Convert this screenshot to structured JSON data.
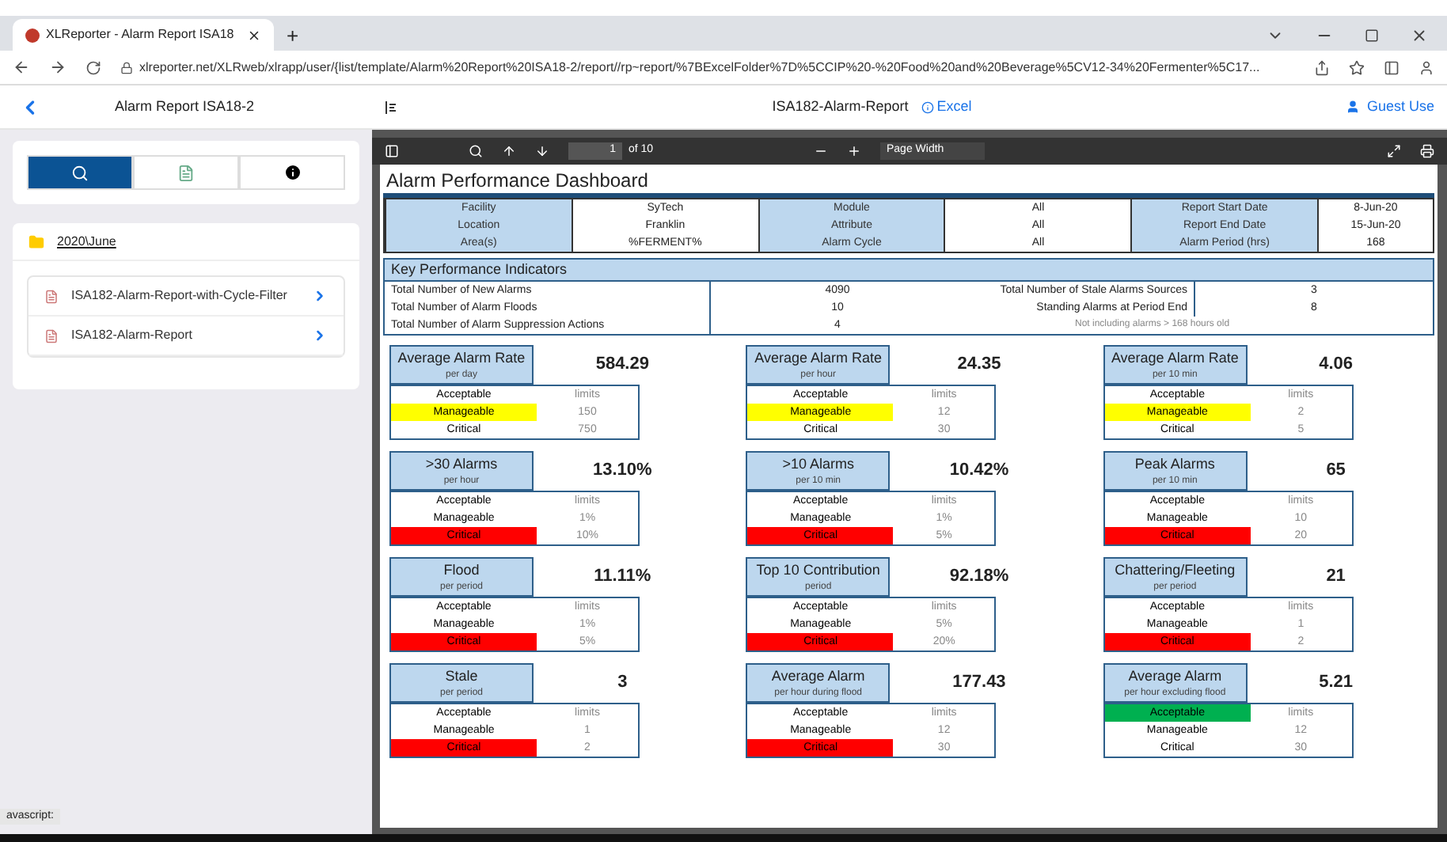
{
  "browser": {
    "tab_title": "XLReporter - Alarm Report ISA18",
    "new_tab": "+",
    "url": "xlreporter.net/XLRweb/xlrapp/user/{list/template/Alarm%20Report%20ISA18-2/report//rp~report/%7BExcelFolder%7D%5CCIP%20-%20Food%20and%20Beverage%5CV12-34%20Fermenter%5C17..."
  },
  "app_header": {
    "title": "Alarm Report ISA18-2",
    "report_name": "ISA182-Alarm-Report",
    "excel_link": "Excel",
    "user": "Guest Use"
  },
  "sidebar": {
    "view_tabs": [
      {
        "selected": true
      },
      {
        "selected": false
      },
      {
        "selected": false
      }
    ],
    "folder": "2020\\June",
    "reports": [
      {
        "name": "ISA182-Alarm-Report-with-Cycle-Filter"
      },
      {
        "name": "ISA182-Alarm-Report"
      }
    ]
  },
  "pdf_toolbar": {
    "page": "1",
    "page_total": "of 10",
    "zoom": "Page Width"
  },
  "report": {
    "title": "Alarm Performance Dashboard",
    "info": [
      [
        {
          "label": "Facility",
          "value": "SyTech"
        },
        {
          "label": "Module",
          "value": "All"
        },
        {
          "label": "Report Start Date",
          "value": "8-Jun-20"
        }
      ],
      [
        {
          "label": "Location",
          "value": "Franklin"
        },
        {
          "label": "Attribute",
          "value": "All"
        },
        {
          "label": "Report End Date",
          "value": "15-Jun-20"
        }
      ],
      [
        {
          "label": "Area(s)",
          "value": "%FERMENT%"
        },
        {
          "label": "Alarm Cycle",
          "value": "All"
        },
        {
          "label": "Alarm Period (hrs)",
          "value": "168"
        }
      ]
    ],
    "kpi_title": "Key Performance Indicators",
    "kpi_rows": [
      {
        "label": "Total Number of New Alarms",
        "value": "4090",
        "label_2": "Total Number of Stale Alarms Sources",
        "value_2": "3"
      },
      {
        "label": "Total Number of Alarm Floods",
        "value": "10",
        "label_2": "Standing Alarms at Period End",
        "value_2": "8"
      },
      {
        "label": "Total Number of Alarm Suppression Actions",
        "value": "4",
        "note": "Not including alarms > 168 hours old"
      }
    ],
    "cards": [
      {
        "title": "Average Alarm Rate",
        "subtitle": "per day",
        "value": "584.29",
        "levels": [
          {
            "label": "Acceptable",
            "limit": "limits"
          },
          {
            "label": "Manageable",
            "limit": "150",
            "color": "#ffff00"
          },
          {
            "label": "Critical",
            "limit": "750"
          }
        ]
      },
      {
        "title": "Average Alarm Rate",
        "subtitle": "per hour",
        "value": "24.35",
        "levels": [
          {
            "label": "Acceptable",
            "limit": "limits"
          },
          {
            "label": "Manageable",
            "limit": "12",
            "color": "#ffff00"
          },
          {
            "label": "Critical",
            "limit": "30"
          }
        ]
      },
      {
        "title": "Average Alarm Rate",
        "subtitle": "per 10 min",
        "value": "4.06",
        "levels": [
          {
            "label": "Acceptable",
            "limit": "limits"
          },
          {
            "label": "Manageable",
            "limit": "2",
            "color": "#ffff00"
          },
          {
            "label": "Critical",
            "limit": "5"
          }
        ]
      },
      {
        "title": ">30 Alarms",
        "subtitle": "per hour",
        "value": "13.10%",
        "levels": [
          {
            "label": "Acceptable",
            "limit": "limits"
          },
          {
            "label": "Manageable",
            "limit": "1%"
          },
          {
            "label": "Critical",
            "limit": "10%",
            "color": "#ff0000"
          }
        ]
      },
      {
        "title": ">10 Alarms",
        "subtitle": "per 10 min",
        "value": "10.42%",
        "levels": [
          {
            "label": "Acceptable",
            "limit": "limits"
          },
          {
            "label": "Manageable",
            "limit": "1%"
          },
          {
            "label": "Critical",
            "limit": "5%",
            "color": "#ff0000"
          }
        ]
      },
      {
        "title": "Peak Alarms",
        "subtitle": "per 10 min",
        "value": "65",
        "levels": [
          {
            "label": "Acceptable",
            "limit": "limits"
          },
          {
            "label": "Manageable",
            "limit": "10"
          },
          {
            "label": "Critical",
            "limit": "20",
            "color": "#ff0000"
          }
        ]
      },
      {
        "title": "Flood",
        "subtitle": "per period",
        "value": "11.11%",
        "levels": [
          {
            "label": "Acceptable",
            "limit": "limits"
          },
          {
            "label": "Manageable",
            "limit": "1%"
          },
          {
            "label": "Critical",
            "limit": "5%",
            "color": "#ff0000"
          }
        ]
      },
      {
        "title": "Top 10 Contribution",
        "subtitle": "period",
        "value": "92.18%",
        "levels": [
          {
            "label": "Acceptable",
            "limit": "limits"
          },
          {
            "label": "Manageable",
            "limit": "5%"
          },
          {
            "label": "Critical",
            "limit": "20%",
            "color": "#ff0000"
          }
        ]
      },
      {
        "title": "Chattering/Fleeting",
        "subtitle": "per period",
        "value": "21",
        "levels": [
          {
            "label": "Acceptable",
            "limit": "limits"
          },
          {
            "label": "Manageable",
            "limit": "1"
          },
          {
            "label": "Critical",
            "limit": "2",
            "color": "#ff0000"
          }
        ]
      },
      {
        "title": "Stale",
        "subtitle": "per period",
        "value": "3",
        "levels": [
          {
            "label": "Acceptable",
            "limit": "limits"
          },
          {
            "label": "Manageable",
            "limit": "1"
          },
          {
            "label": "Critical",
            "limit": "2",
            "color": "#ff0000"
          }
        ]
      },
      {
        "title": "Average Alarm",
        "subtitle": "per hour during flood",
        "value": "177.43",
        "levels": [
          {
            "label": "Acceptable",
            "limit": "limits"
          },
          {
            "label": "Manageable",
            "limit": "12"
          },
          {
            "label": "Critical",
            "limit": "30",
            "color": "#ff0000"
          }
        ]
      },
      {
        "title": "Average Alarm",
        "subtitle": "per hour excluding flood",
        "value": "5.21",
        "levels": [
          {
            "label": "Acceptable",
            "limit": "limits",
            "color": "#00b050"
          },
          {
            "label": "Manageable",
            "limit": "12"
          },
          {
            "label": "Critical",
            "limit": "30"
          }
        ]
      }
    ]
  },
  "status_text": "avascript:"
}
